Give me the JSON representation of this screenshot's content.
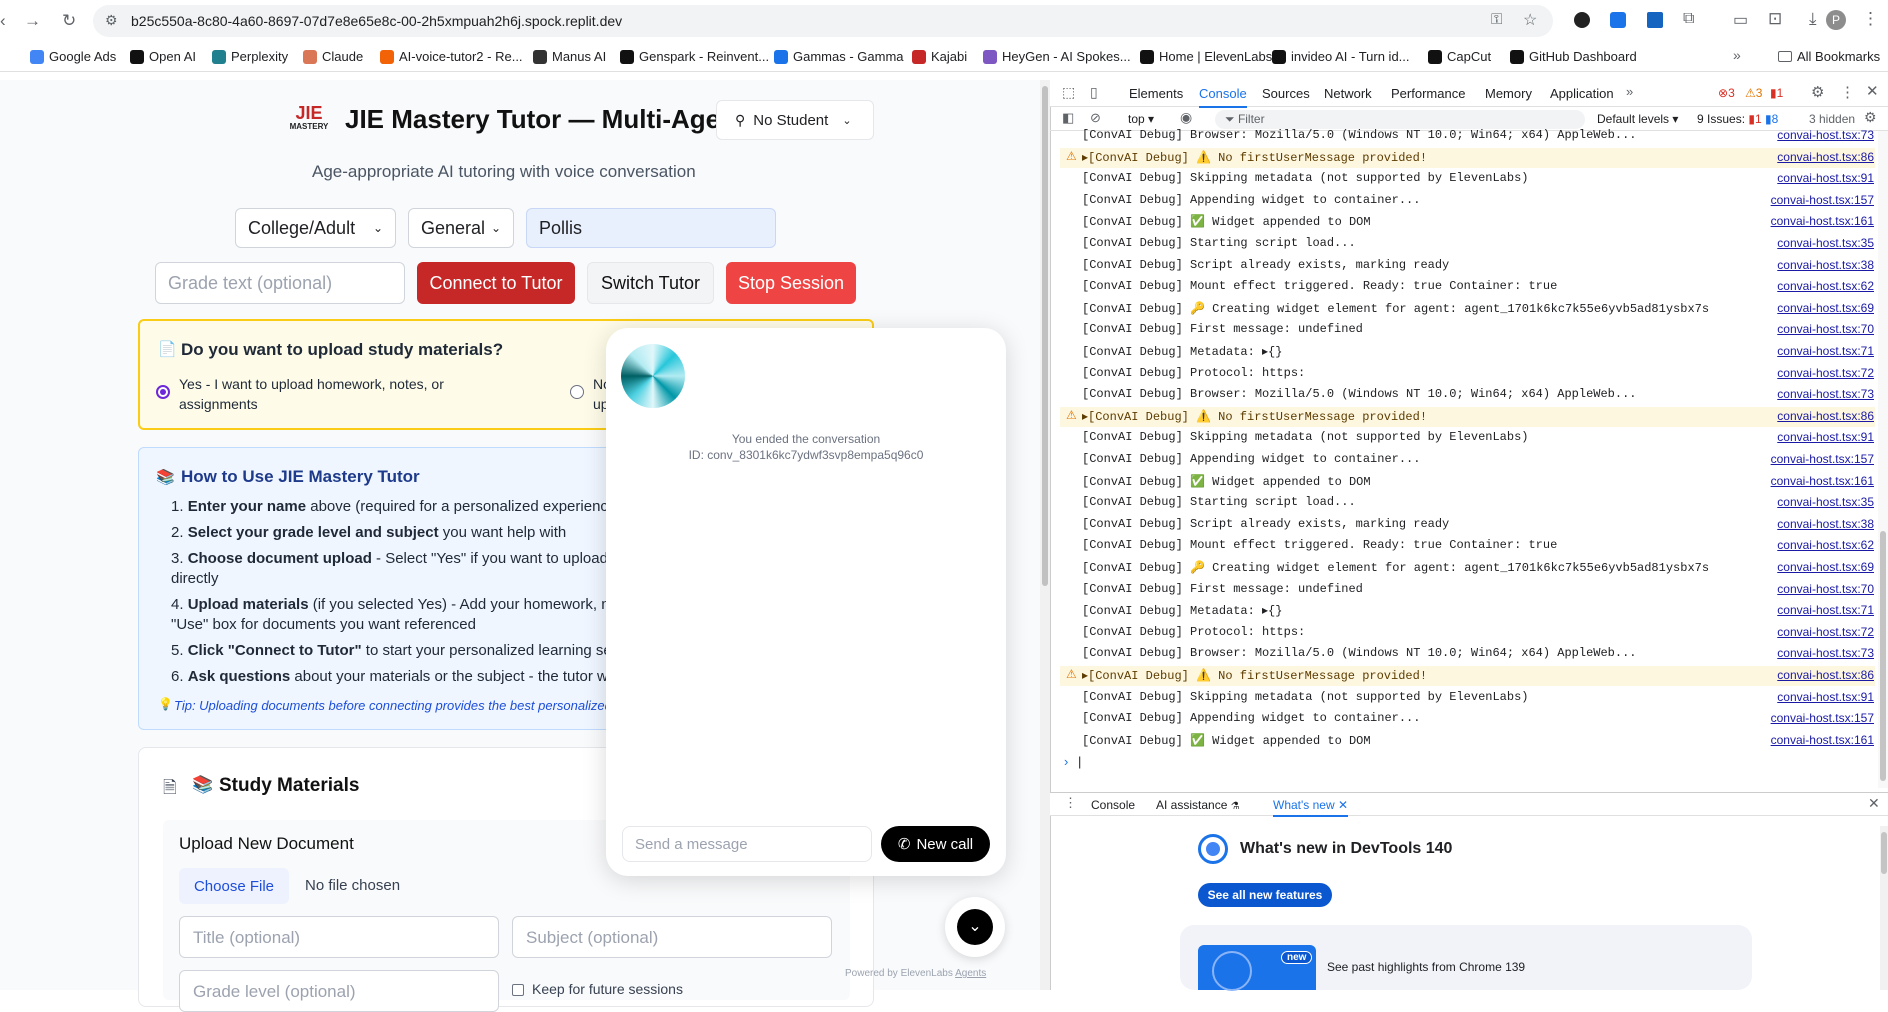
{
  "browser": {
    "url": "b25c550a-8c80-4a60-8697-07d7e8e65e8c-00-2h5xmpuah2h6j.spock.replit.dev",
    "bookmarks": [
      {
        "label": "Google Ads",
        "color": "#4285f4"
      },
      {
        "label": "Open AI",
        "color": "#111"
      },
      {
        "label": "Perplexity",
        "color": "#20808d"
      },
      {
        "label": "Claude",
        "color": "#d97757"
      },
      {
        "label": "AI-voice-tutor2 - Re...",
        "color": "#f26207"
      },
      {
        "label": "Manus AI",
        "color": "#333"
      },
      {
        "label": "Genspark - Reinvent...",
        "color": "#111"
      },
      {
        "label": "Gammas - Gamma",
        "color": "#1a73e8"
      },
      {
        "label": "Kajabi",
        "color": "#c62828"
      },
      {
        "label": "HeyGen - AI Spokes...",
        "color": "#7e57c2"
      },
      {
        "label": "Home | ElevenLabs",
        "color": "#111"
      },
      {
        "label": "invideo AI - Turn id...",
        "color": "#111"
      },
      {
        "label": "CapCut",
        "color": "#111"
      },
      {
        "label": "GitHub Dashboard",
        "color": "#111"
      }
    ],
    "all_bookmarks": "All Bookmarks",
    "profile_initial": "P"
  },
  "app": {
    "logo_top": "JIE",
    "logo_bottom": "MASTERY",
    "title": "JIE Mastery Tutor — Multi-Agent",
    "subtitle": "Age-appropriate AI tutoring with voice conversation",
    "student_select": "No Student",
    "grade_select": "College/Adult",
    "subject_select": "General",
    "name_input": "Pollis",
    "grade_text_placeholder": "Grade text (optional)",
    "connect_button": "Connect to Tutor",
    "switch_button": "Switch Tutor",
    "stop_button": "Stop Session",
    "upload_question": "Do you want to upload study materials?",
    "upload_yes": "Yes - I want to upload homework, notes, or assignments",
    "upload_no_partial": "No",
    "upload_no_partial2": "up",
    "how_title": "How to Use JIE Mastery Tutor",
    "steps": [
      {
        "num": "1.",
        "bold": "Enter your name",
        "rest": " above (required for a personalized experience)"
      },
      {
        "num": "2.",
        "bold": "Select your grade level and subject",
        "rest": " you want help with"
      },
      {
        "num": "3.",
        "bold": "Choose document upload",
        "rest": " - Select \"Yes\" if you want to upload ho"
      },
      {
        "num": "",
        "bold": "",
        "rest": "directly"
      },
      {
        "num": "4.",
        "bold": "Upload materials",
        "rest": " (if you selected Yes) - Add your homework, note"
      },
      {
        "num": "",
        "bold": "",
        "rest": "\"Use\" box for documents you want referenced"
      },
      {
        "num": "5.",
        "bold": "Click \"Connect to Tutor\"",
        "rest": " to start your personalized learning sessi"
      },
      {
        "num": "6.",
        "bold": "Ask questions",
        "rest": " about your materials or the subject - the tutor will h"
      }
    ],
    "tip": "Tip: Uploading documents before connecting provides the best personalized",
    "study_title": "Study Materials",
    "upload_new": "Upload New Document",
    "choose_file": "Choose File",
    "no_file": "No file chosen",
    "title_placeholder": "Title (optional)",
    "subject_placeholder": "Subject (optional)",
    "grade_level_placeholder": "Grade level (optional)",
    "keep_label": "Keep for future sessions"
  },
  "widget": {
    "ended": "You ended the conversation",
    "id": "ID: conv_8301k6kc7ydwf3svp8empa5q96c0",
    "message_placeholder": "Send a message",
    "new_call": "New call",
    "powered": "Powered by ElevenLabs",
    "agents": "Agents"
  },
  "devtools": {
    "tabs": [
      "Elements",
      "Console",
      "Sources",
      "Network",
      "Performance",
      "Memory",
      "Application"
    ],
    "active_tab": "Console",
    "errors": "3",
    "warnings": "3",
    "infos": "1",
    "context": "top",
    "filter_placeholder": "Filter",
    "levels": "Default levels",
    "issues_label": "9 Issues:",
    "issues_err": "1",
    "issues_info": "8",
    "hidden": "3 hidden",
    "logs": [
      {
        "text": "[ConvAI Debug] Browser: Mozilla/5.0 (Windows NT 10.0; Win64; x64) AppleWeb...",
        "src": "convai-host.tsx:73",
        "warn": false
      },
      {
        "text": "▸[ConvAI Debug] ⚠️ No firstUserMessage provided!",
        "src": "convai-host.tsx:86",
        "warn": true
      },
      {
        "text": "[ConvAI Debug] Skipping metadata (not supported by ElevenLabs)",
        "src": "convai-host.tsx:91",
        "warn": false
      },
      {
        "text": "[ConvAI Debug] Appending widget to container...",
        "src": "convai-host.tsx:157",
        "warn": false
      },
      {
        "text": "[ConvAI Debug] ✅ Widget appended to DOM",
        "src": "convai-host.tsx:161",
        "warn": false
      },
      {
        "text": "[ConvAI Debug] Starting script load...",
        "src": "convai-host.tsx:35",
        "warn": false
      },
      {
        "text": "[ConvAI Debug] Script already exists, marking ready",
        "src": "convai-host.tsx:38",
        "warn": false
      },
      {
        "text": "[ConvAI Debug] Mount effect triggered. Ready: true Container: true",
        "src": "convai-host.tsx:62",
        "warn": false
      },
      {
        "text": "[ConvAI Debug] 🔑 Creating widget element for agent: agent_1701k6kc7k55e6yvb5ad81ysbx7s",
        "src": "convai-host.tsx:69",
        "warn": false
      },
      {
        "text": "[ConvAI Debug] First message: undefined",
        "src": "convai-host.tsx:70",
        "warn": false
      },
      {
        "text": "[ConvAI Debug] Metadata:  ▸{}",
        "src": "convai-host.tsx:71",
        "warn": false
      },
      {
        "text": "[ConvAI Debug] Protocol: https:",
        "src": "convai-host.tsx:72",
        "warn": false
      },
      {
        "text": "[ConvAI Debug] Browser: Mozilla/5.0 (Windows NT 10.0; Win64; x64) AppleWeb...",
        "src": "convai-host.tsx:73",
        "warn": false
      },
      {
        "text": "▸[ConvAI Debug] ⚠️ No firstUserMessage provided!",
        "src": "convai-host.tsx:86",
        "warn": true
      },
      {
        "text": "[ConvAI Debug] Skipping metadata (not supported by ElevenLabs)",
        "src": "convai-host.tsx:91",
        "warn": false
      },
      {
        "text": "[ConvAI Debug] Appending widget to container...",
        "src": "convai-host.tsx:157",
        "warn": false
      },
      {
        "text": "[ConvAI Debug] ✅ Widget appended to DOM",
        "src": "convai-host.tsx:161",
        "warn": false
      },
      {
        "text": "[ConvAI Debug] Starting script load...",
        "src": "convai-host.tsx:35",
        "warn": false
      },
      {
        "text": "[ConvAI Debug] Script already exists, marking ready",
        "src": "convai-host.tsx:38",
        "warn": false
      },
      {
        "text": "[ConvAI Debug] Mount effect triggered. Ready: true Container: true",
        "src": "convai-host.tsx:62",
        "warn": false
      },
      {
        "text": "[ConvAI Debug] 🔑 Creating widget element for agent: agent_1701k6kc7k55e6yvb5ad81ysbx7s",
        "src": "convai-host.tsx:69",
        "warn": false
      },
      {
        "text": "[ConvAI Debug] First message: undefined",
        "src": "convai-host.tsx:70",
        "warn": false
      },
      {
        "text": "[ConvAI Debug] Metadata:  ▸{}",
        "src": "convai-host.tsx:71",
        "warn": false
      },
      {
        "text": "[ConvAI Debug] Protocol: https:",
        "src": "convai-host.tsx:72",
        "warn": false
      },
      {
        "text": "[ConvAI Debug] Browser: Mozilla/5.0 (Windows NT 10.0; Win64; x64) AppleWeb...",
        "src": "convai-host.tsx:73",
        "warn": false
      },
      {
        "text": "▸[ConvAI Debug] ⚠️ No firstUserMessage provided!",
        "src": "convai-host.tsx:86",
        "warn": true
      },
      {
        "text": "[ConvAI Debug] Skipping metadata (not supported by ElevenLabs)",
        "src": "convai-host.tsx:91",
        "warn": false
      },
      {
        "text": "[ConvAI Debug] Appending widget to container...",
        "src": "convai-host.tsx:157",
        "warn": false
      },
      {
        "text": "[ConvAI Debug] ✅ Widget appended to DOM",
        "src": "convai-host.tsx:161",
        "warn": false
      }
    ],
    "drawer_tabs": [
      "Console",
      "AI assistance",
      "What's new"
    ],
    "whats_new_title": "What's new in DevTools 140",
    "see_all": "See all new features",
    "new_badge": "new",
    "past_highlights": "See past highlights from Chrome 139"
  }
}
